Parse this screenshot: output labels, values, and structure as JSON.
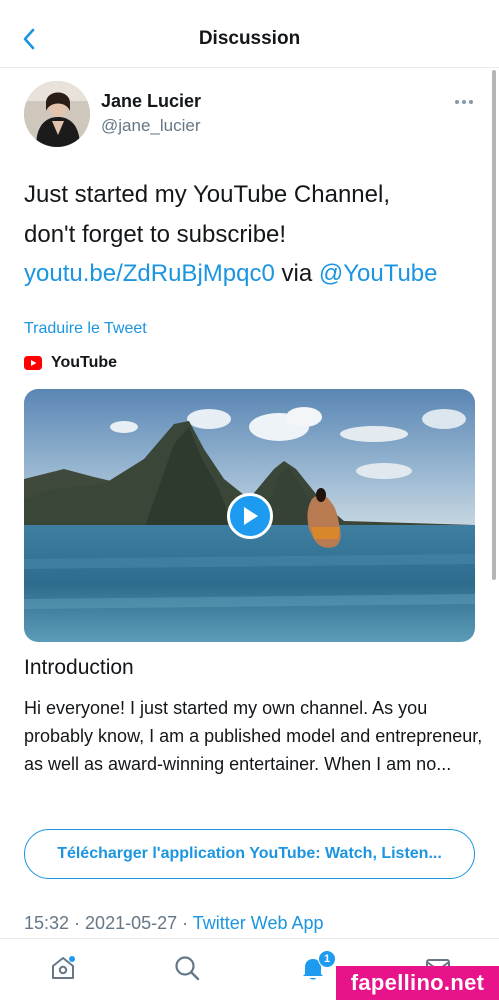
{
  "header": {
    "title": "Discussion"
  },
  "author": {
    "name": "Jane Lucier",
    "handle": "@jane_lucier"
  },
  "tweet": {
    "line1": "Just started my YouTube Channel,",
    "line2": "don't forget to subscribe!",
    "link": "youtu.be/ZdRuBjMpqc0",
    "via": " via ",
    "mention": "@YouTube"
  },
  "translate_label": "Traduire le Tweet",
  "card": {
    "source_name": "YouTube",
    "title": "Introduction",
    "description": "Hi everyone! I just started my own channel. As you probably know, I am a published model and entrepreneur, as well as award-winning entertainer. When I am no..."
  },
  "app_button_label": "Télécharger l'application YouTube: Watch, Listen...",
  "meta": {
    "time": "15:32",
    "separator": " · ",
    "date": "2021-05-27",
    "source": "Twitter Web App"
  },
  "tabbar": {
    "icons": [
      "home-icon",
      "search-icon",
      "notifications-icon",
      "messages-icon"
    ],
    "notification_count": "1"
  },
  "watermark": "fapellino.net",
  "colors": {
    "accent": "#1b95e0",
    "secondary_text": "#657786",
    "youtube_red": "#ff0000",
    "watermark_bg": "#e8138a"
  }
}
